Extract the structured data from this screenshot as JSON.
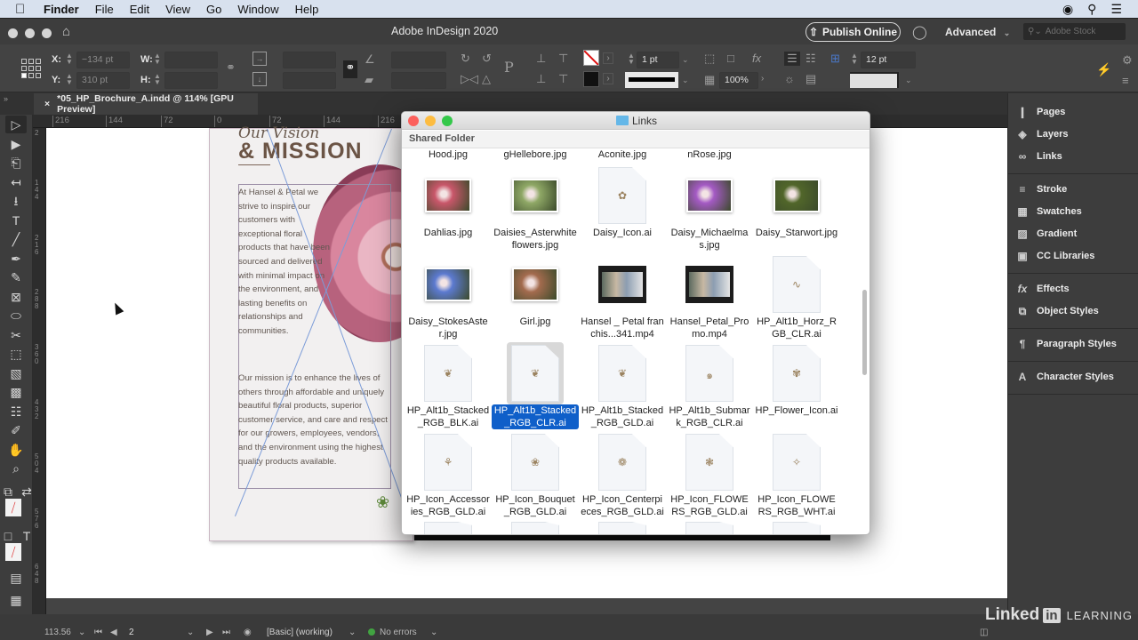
{
  "menubar": {
    "apple_icon": "apple-logo",
    "items": [
      "Finder",
      "File",
      "Edit",
      "View",
      "Go",
      "Window",
      "Help"
    ],
    "right_icons": [
      "creative-cloud-icon",
      "spotlight-search-icon",
      "notification-list-icon"
    ]
  },
  "app": {
    "title": "Adobe InDesign 2020",
    "publish_label": "Publish Online",
    "workspace": "Advanced",
    "stock_placeholder": "Adobe Stock"
  },
  "control_panel": {
    "x_label": "X:",
    "x_value": "−134 pt",
    "y_label": "Y:",
    "y_value": "310 pt",
    "w_label": "W:",
    "w_value": "",
    "h_label": "H:",
    "h_value": "",
    "stroke_weight": "1 pt",
    "opacity": "100%",
    "gutter": "12 pt"
  },
  "document_tab": {
    "title": "*05_HP_Brochure_A.indd @ 114% [GPU Preview]",
    "close": "×"
  },
  "ruler": {
    "horizontal": [
      "216",
      "144",
      "72",
      "0",
      "72",
      "144",
      "216"
    ],
    "vertical": [
      "2",
      "144",
      "216",
      "288",
      "360",
      "432",
      "504",
      "576",
      "648"
    ]
  },
  "page": {
    "script_title": "Our Vision",
    "main_title": "& MISSION",
    "para1": "At Hansel & Petal we strive to inspire our customers with exceptional floral products that have been sourced and delivered with minimal impact on the environment, and lasting benefits on relationships and communities.",
    "para2": "Our mission is to enhance the lives of others through affordable and uniquely beautiful floral products, superior customer service, and care and respect for our growers, employees, vendors, and the environment using the highest quality products available."
  },
  "finder": {
    "title": "Links",
    "path": "Shared Folder",
    "partial_row": [
      "Hood.jpg",
      "gHellebore.jpg",
      "Aconite.jpg",
      "nRose.jpg",
      ""
    ],
    "items": [
      {
        "name": "Dahlias.jpg",
        "kind": "image",
        "color": "#c9576a"
      },
      {
        "name": "Daisies_Asterwhiteflowers.jpg",
        "kind": "image",
        "color": "#8fa866"
      },
      {
        "name": "Daisy_Icon.ai",
        "kind": "doc",
        "glyph": "✿"
      },
      {
        "name": "Daisy_Michaelmas.jpg",
        "kind": "image",
        "color": "#a45ac4"
      },
      {
        "name": "Daisy_Starwort.jpg",
        "kind": "image",
        "color": "#51662a"
      },
      {
        "name": "Daisy_StokesAster.jpg",
        "kind": "image",
        "color": "#5c7ad0"
      },
      {
        "name": "Girl.jpg",
        "kind": "image",
        "color": "#a36b4e"
      },
      {
        "name": "Hansel _ Petal franchis...341.mp4",
        "kind": "video"
      },
      {
        "name": "Hansel_Petal_Promo.mp4",
        "kind": "video"
      },
      {
        "name": "HP_Alt1b_Horz_RGB_CLR.ai",
        "kind": "doc",
        "glyph": "∿"
      },
      {
        "name": "HP_Alt1b_Stacked_RGB_BLK.ai",
        "kind": "doc",
        "glyph": "❦"
      },
      {
        "name": "HP_Alt1b_Stacked_RGB_CLR.ai",
        "kind": "doc",
        "glyph": "❦",
        "selected": true
      },
      {
        "name": "HP_Alt1b_Stacked_RGB_GLD.ai",
        "kind": "doc",
        "glyph": "❦"
      },
      {
        "name": "HP_Alt1b_Submark_RGB_CLR.ai",
        "kind": "doc",
        "glyph": "๑"
      },
      {
        "name": "HP_Flower_Icon.ai",
        "kind": "doc",
        "glyph": "✾"
      },
      {
        "name": "HP_Icon_Accessories_RGB_GLD.ai",
        "kind": "doc",
        "glyph": "⚘"
      },
      {
        "name": "HP_Icon_Bouquet_RGB_GLD.ai",
        "kind": "doc",
        "glyph": "❀"
      },
      {
        "name": "HP_Icon_Centerpieces_RGB_GLD.ai",
        "kind": "doc",
        "glyph": "❁"
      },
      {
        "name": "HP_Icon_FLOWERS_RGB_GLD.ai",
        "kind": "doc",
        "glyph": "❃"
      },
      {
        "name": "HP_Icon_FLOWERS_RGB_WHT.ai",
        "kind": "doc",
        "glyph": "✧"
      }
    ]
  },
  "panels": {
    "groups": [
      [
        {
          "label": "Pages",
          "icon": "pages-icon",
          "glyph": "❙"
        },
        {
          "label": "Layers",
          "icon": "layers-icon",
          "glyph": "◈"
        },
        {
          "label": "Links",
          "icon": "links-icon",
          "glyph": "∞"
        }
      ],
      [
        {
          "label": "Stroke",
          "icon": "stroke-icon",
          "glyph": "≡"
        },
        {
          "label": "Swatches",
          "icon": "swatches-icon",
          "glyph": "▦"
        },
        {
          "label": "Gradient",
          "icon": "gradient-icon",
          "glyph": "▨"
        },
        {
          "label": "CC Libraries",
          "icon": "cc-libraries-icon",
          "glyph": "▣"
        }
      ],
      [
        {
          "label": "Effects",
          "icon": "effects-icon",
          "glyph": "fx"
        },
        {
          "label": "Object Styles",
          "icon": "object-styles-icon",
          "glyph": "⧉"
        }
      ],
      [
        {
          "label": "Paragraph Styles",
          "icon": "paragraph-styles-icon",
          "glyph": "¶"
        }
      ],
      [
        {
          "label": "Character Styles",
          "icon": "character-styles-icon",
          "glyph": "A"
        }
      ]
    ]
  },
  "tools": [
    {
      "name": "selection-tool-icon",
      "glyph": "▷",
      "active": true
    },
    {
      "name": "direct-selection-tool-icon",
      "glyph": "▶"
    },
    {
      "name": "page-tool-icon",
      "glyph": "⎗"
    },
    {
      "name": "gap-tool-icon",
      "glyph": "↤"
    },
    {
      "name": "content-collector-icon",
      "glyph": "⭳"
    },
    {
      "name": "type-tool-icon",
      "glyph": "T"
    },
    {
      "name": "line-tool-icon",
      "glyph": "╱"
    },
    {
      "name": "pen-tool-icon",
      "glyph": "✒"
    },
    {
      "name": "pencil-tool-icon",
      "glyph": "✎"
    },
    {
      "name": "rectangle-frame-tool-icon",
      "glyph": "⊠"
    },
    {
      "name": "ellipse-tool-icon",
      "glyph": "⬭"
    },
    {
      "name": "scissors-tool-icon",
      "glyph": "✂"
    },
    {
      "name": "free-transform-tool-icon",
      "glyph": "⬚"
    },
    {
      "name": "gradient-swatch-tool-icon",
      "glyph": "▧"
    },
    {
      "name": "gradient-feather-tool-icon",
      "glyph": "▩"
    },
    {
      "name": "note-tool-icon",
      "glyph": "☷"
    },
    {
      "name": "eyedropper-tool-icon",
      "glyph": "✐"
    },
    {
      "name": "hand-tool-icon",
      "glyph": "✋"
    },
    {
      "name": "zoom-tool-icon",
      "glyph": "⌕"
    }
  ],
  "status": {
    "zoom": "113.56",
    "page": "2",
    "preflight_profile": "[Basic] (working)",
    "errors": "No errors"
  },
  "branding": {
    "linkedin_word": "Linked",
    "linkedin_in": "in",
    "learning": "LEARNING"
  }
}
